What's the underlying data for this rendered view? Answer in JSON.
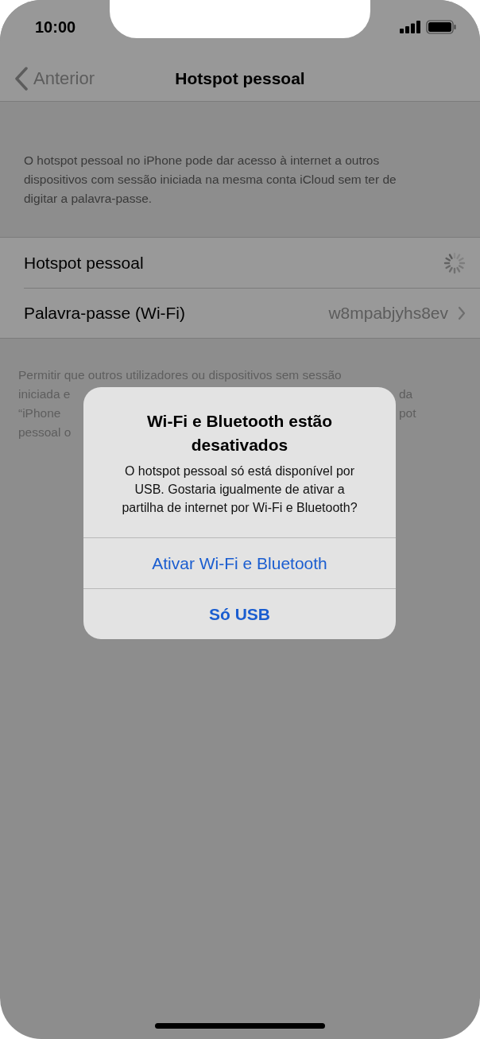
{
  "status_bar": {
    "time": "10:00"
  },
  "nav": {
    "back": "Anterior",
    "title": "Hotspot pessoal"
  },
  "description": "O hotspot pessoal no iPhone pode dar acesso à internet a outros dispositivos com sessão iniciada na mesma conta iCloud sem ter de digitar a palavra-passe.",
  "rows": [
    {
      "kind": "spinner",
      "label": "Hotspot pessoal"
    },
    {
      "kind": "disclosure",
      "label": "Palavra-passe (Wi-Fi)",
      "value": "w8mpabjyhs8ev"
    }
  ],
  "footer_lines": [
    {
      "left": "Permitir que outros utilizadores ou dispositivos sem sessão"
    },
    {
      "left": "iniciada e",
      "right": "da"
    },
    {
      "left": "“iPhone",
      "right": "pot"
    },
    {
      "left": "pessoal o"
    }
  ],
  "alert": {
    "title": "Wi-Fi e Bluetooth estão desativados",
    "message": "O hotspot pessoal só está disponível por USB. Gostaria igualmente de ativar a partilha de internet por Wi-Fi e Bluetooth?",
    "buttons": [
      {
        "label": "Ativar Wi-Fi e Bluetooth",
        "bold": false
      },
      {
        "label": "Só USB",
        "bold": true
      }
    ]
  }
}
